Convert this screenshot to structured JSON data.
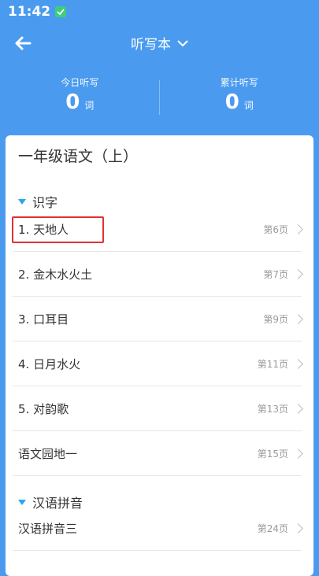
{
  "status": {
    "time": "11:42"
  },
  "nav": {
    "title": "听写本"
  },
  "stats": {
    "today": {
      "label": "今日听写",
      "value": "0",
      "unit": "词"
    },
    "total": {
      "label": "累计听写",
      "value": "0",
      "unit": "词"
    }
  },
  "book": {
    "title": "一年级语文（上）"
  },
  "sections": [
    {
      "name": "识字",
      "lessons": [
        {
          "title": "1. 天地人",
          "page": "第6页"
        },
        {
          "title": "2. 金木水火土",
          "page": "第7页"
        },
        {
          "title": "3. 口耳目",
          "page": "第9页"
        },
        {
          "title": "4. 日月水火",
          "page": "第11页"
        },
        {
          "title": "5. 对韵歌",
          "page": "第13页"
        },
        {
          "title": "语文园地一",
          "page": "第15页"
        }
      ]
    },
    {
      "name": "汉语拼音",
      "lessons": [
        {
          "title": "汉语拼音三",
          "page": "第24页"
        }
      ]
    }
  ],
  "colors": {
    "header": "#4a9bf0",
    "accent": "#2aa6f0",
    "highlight": "#dd3333"
  }
}
